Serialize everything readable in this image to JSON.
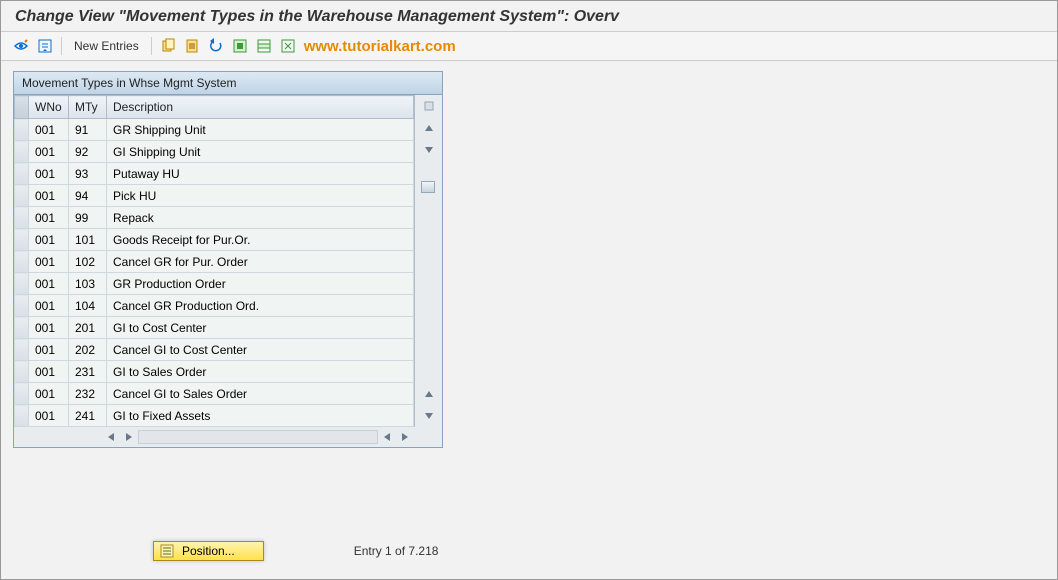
{
  "title": "Change View \"Movement Types in the Warehouse Management System\": Overv",
  "toolbar": {
    "new_entries": "New Entries",
    "watermark": "www.tutorialkart.com"
  },
  "panel": {
    "header": "Movement Types in Whse Mgmt System",
    "columns": {
      "wno": "WNo",
      "mty": "MTy",
      "desc": "Description"
    },
    "rows": [
      {
        "wno": "001",
        "mty": "91",
        "desc": "GR Shipping Unit"
      },
      {
        "wno": "001",
        "mty": "92",
        "desc": "GI Shipping Unit"
      },
      {
        "wno": "001",
        "mty": "93",
        "desc": "Putaway HU"
      },
      {
        "wno": "001",
        "mty": "94",
        "desc": "Pick HU"
      },
      {
        "wno": "001",
        "mty": "99",
        "desc": "Repack"
      },
      {
        "wno": "001",
        "mty": "101",
        "desc": "Goods Receipt for Pur.Or."
      },
      {
        "wno": "001",
        "mty": "102",
        "desc": "Cancel GR for Pur. Order"
      },
      {
        "wno": "001",
        "mty": "103",
        "desc": "GR Production Order"
      },
      {
        "wno": "001",
        "mty": "104",
        "desc": "Cancel GR Production Ord."
      },
      {
        "wno": "001",
        "mty": "201",
        "desc": "GI to Cost Center"
      },
      {
        "wno": "001",
        "mty": "202",
        "desc": "Cancel GI to Cost Center"
      },
      {
        "wno": "001",
        "mty": "231",
        "desc": "GI to Sales Order"
      },
      {
        "wno": "001",
        "mty": "232",
        "desc": "Cancel GI to Sales Order"
      },
      {
        "wno": "001",
        "mty": "241",
        "desc": "GI to Fixed Assets"
      }
    ]
  },
  "footer": {
    "position_btn": "Position...",
    "status": "Entry 1 of 7.218"
  },
  "colors": {
    "watermark": "#e68a00",
    "header_grad_top": "#dde9f4",
    "header_grad_bot": "#bfd4e6",
    "position_btn_bg": "#ffe24d"
  }
}
